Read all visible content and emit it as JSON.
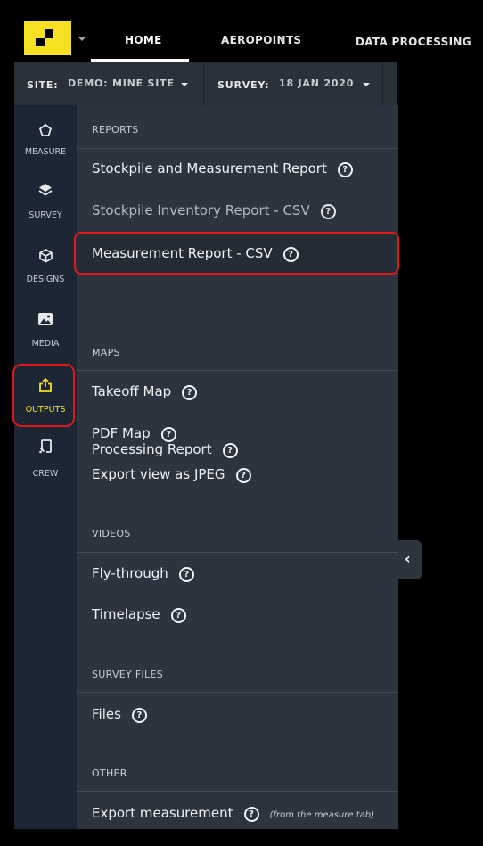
{
  "topnav": {
    "home": "HOME",
    "aeropoints": "AEROPOINTS",
    "data_processing": "DATA PROCESSING"
  },
  "sitebar": {
    "site_label": "SITE:",
    "site_value": "DEMO: MINE SITE",
    "survey_label": "SURVEY:",
    "survey_value": "18 JAN 2020"
  },
  "sidebar": {
    "items": [
      {
        "label": "MEASURE",
        "icon": "pentagon-outline-icon"
      },
      {
        "label": "SURVEY",
        "icon": "layers-icon"
      },
      {
        "label": "DESIGNS",
        "icon": "cube-icon"
      },
      {
        "label": "MEDIA",
        "icon": "image-icon"
      },
      {
        "label": "OUTPUTS",
        "icon": "share-upload-icon"
      },
      {
        "label": "CREW",
        "icon": "cast-icon"
      }
    ],
    "active_color": "#f5e121"
  },
  "panel": {
    "reports": {
      "heading": "REPORTS",
      "items": [
        "Stockpile and Measurement Report",
        "Stockpile Inventory Report - CSV",
        "Measurement Report - CSV",
        "Processing Report"
      ]
    },
    "maps": {
      "heading": "MAPS",
      "items": [
        "Takeoff Map",
        "PDF Map",
        "Export view as JPEG"
      ]
    },
    "videos": {
      "heading": "VIDEOS",
      "items": [
        "Fly-through",
        "Timelapse"
      ]
    },
    "survey_files": {
      "heading": "SURVEY FILES",
      "items": [
        "Files"
      ]
    },
    "other": {
      "heading": "OTHER",
      "items": [
        "Export measurement"
      ],
      "note": "(from the measure tab)"
    }
  },
  "colors": {
    "highlight": "#e0181b",
    "brand": "#f5e121",
    "panel": "#2d3440",
    "sidebar": "#1d2634"
  }
}
